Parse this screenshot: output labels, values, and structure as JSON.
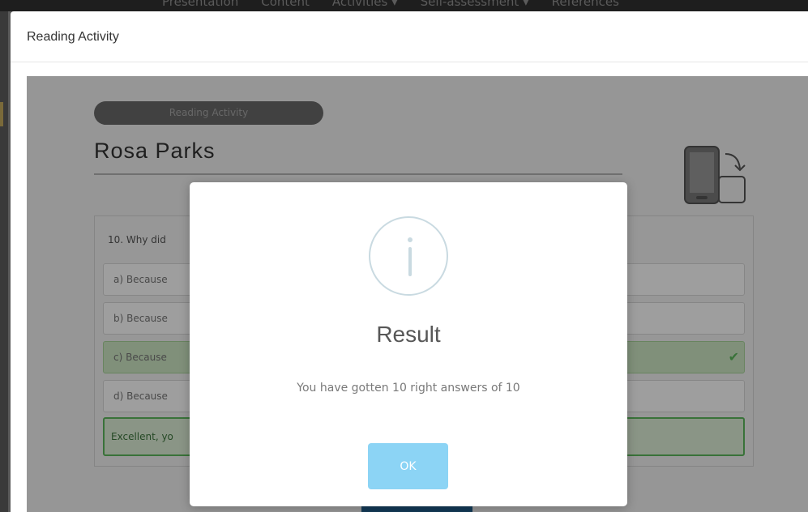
{
  "nav": {
    "items": [
      "Presentation",
      "Content",
      "Activities ▾",
      "Self-assessment ▾",
      "References"
    ]
  },
  "window": {
    "title": "Reading Activity"
  },
  "activity": {
    "badge": "Reading Activity",
    "title": "Rosa Parks",
    "question": "10. Why did",
    "options": [
      "a) Because",
      "b) Because",
      "c) Because",
      "d) Because"
    ],
    "correct_option_index": 2,
    "feedback": "Excellent, yo"
  },
  "modal": {
    "icon": "info-icon",
    "title": "Result",
    "message": "You have gotten 10 right answers of 10",
    "ok_label": "OK"
  },
  "colors": {
    "correct": "#5cb85c",
    "ok_button": "#8cd4f5"
  }
}
